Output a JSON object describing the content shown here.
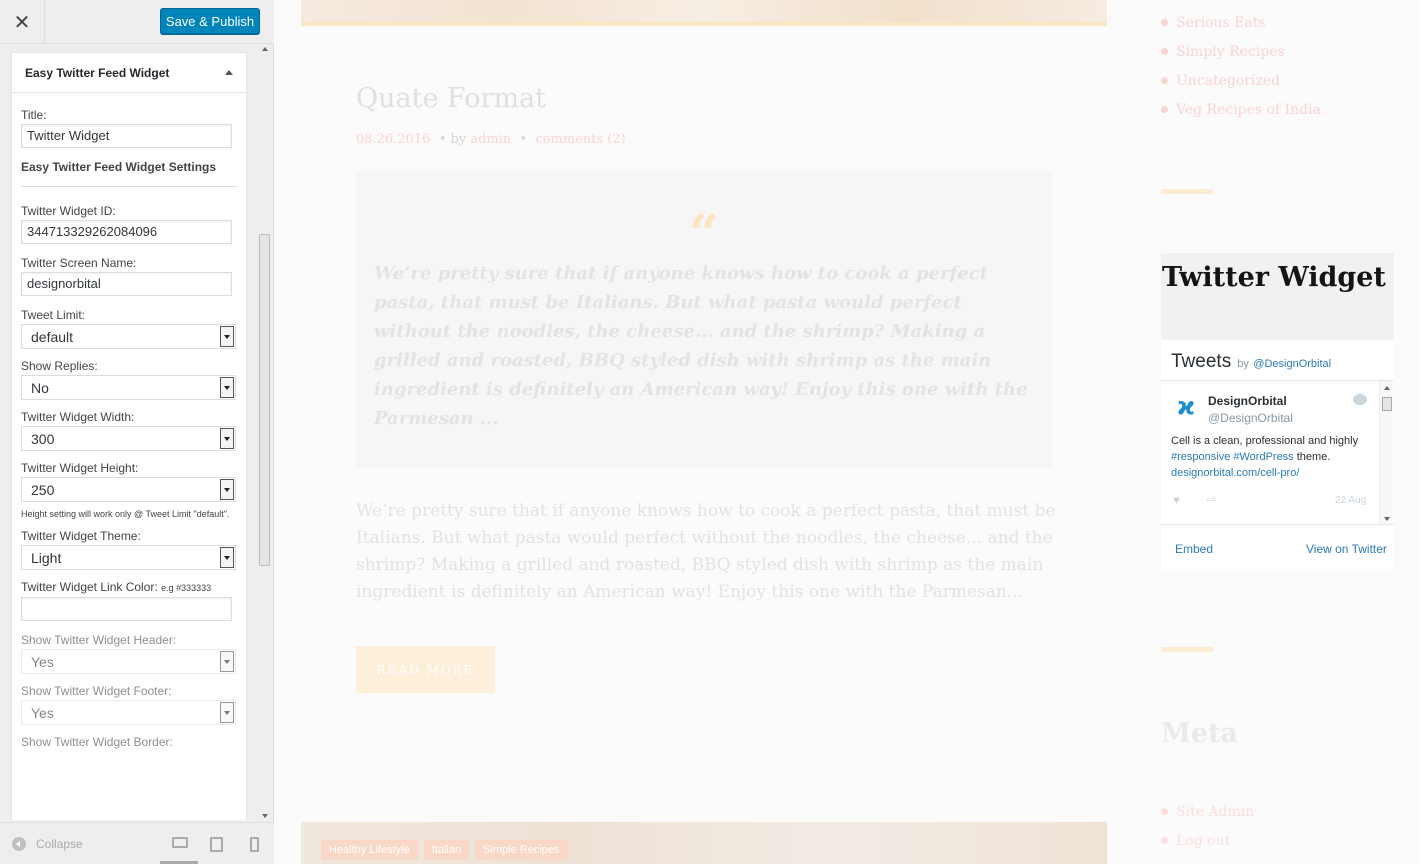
{
  "customizer": {
    "close_icon": "close-icon",
    "publish_label": "Save & Publish",
    "widget_title": "Easy Twitter Feed Widget",
    "fields": {
      "title_label": "Title:",
      "title_value": "Twitter Widget",
      "settings_heading": "Easy Twitter Feed Widget Settings",
      "widget_id_label": "Twitter Widget ID:",
      "widget_id_value": "344713329262084096",
      "screen_name_label": "Twitter Screen Name:",
      "screen_name_value": "designorbital",
      "tweet_limit_label": "Tweet Limit:",
      "tweet_limit_value": "default",
      "show_replies_label": "Show Replies:",
      "show_replies_value": "No",
      "width_label": "Twitter Widget Width:",
      "width_value": "300",
      "height_label": "Twitter Widget Height:",
      "height_value": "250",
      "height_note": "Height setting will work only @ Tweet Limit \"default\".",
      "theme_label": "Twitter Widget Theme:",
      "theme_value": "Light",
      "link_color_label": "Twitter Widget Link Color:",
      "link_color_hint": "e.g #333333",
      "link_color_value": "",
      "header_label": "Show Twitter Widget Header:",
      "header_value": "Yes",
      "footer_label": "Show Twitter Widget Footer:",
      "footer_value": "Yes",
      "border_label": "Show Twitter Widget Border:"
    },
    "footer": {
      "collapse_label": "Collapse"
    }
  },
  "preview": {
    "post": {
      "title": "Quate Format",
      "date": "08.26.2016",
      "by": "• by",
      "author": "admin",
      "sep": "•",
      "comments": "comments (2)",
      "quote": "We’re pretty sure that if anyone knows how to cook a perfect pasta, that must be Italians. But what pasta would perfect without the noodles, the cheese... and the shrimp? Making a grilled and roasted, BBQ styled dish with shrimp as the main ingredient is definitely an American way! Enjoy this one with the Parmesan ...",
      "excerpt": "We’re pretty sure that if anyone knows how to cook a perfect pasta, that must be Italians. But what pasta would perfect without the noodles, the cheese... and the shrimp? Making a grilled and roasted, BBQ styled dish with shrimp as the main ingredient is definitely an American way! Enjoy this one with the Parmesan...",
      "read_more": "READ MORE",
      "tags": [
        "Healthy Lifestyle",
        "Italian",
        "Simple Recipes"
      ]
    },
    "categories": [
      "Serious Eats",
      "Simply Recipes",
      "Uncategorized",
      "Veg Recipes of India"
    ],
    "twitter_widget": {
      "title": "Twitter Widget",
      "tweets_label": "Tweets",
      "by": "by",
      "handle": "@DesignOrbital",
      "tweet": {
        "name": "DesignOrbital",
        "screen": "@DesignOrbital",
        "text_start": "Cell is a clean, professional and highly",
        "hashtags": "#responsive #WordPress",
        "text_end": "theme.",
        "link": "designorbital.com/cell-pro/",
        "date": "22 Aug"
      },
      "embed": "Embed",
      "view": "View on Twitter"
    },
    "meta": {
      "title": "Meta",
      "items": [
        "Site Admin",
        "Log out"
      ]
    }
  }
}
